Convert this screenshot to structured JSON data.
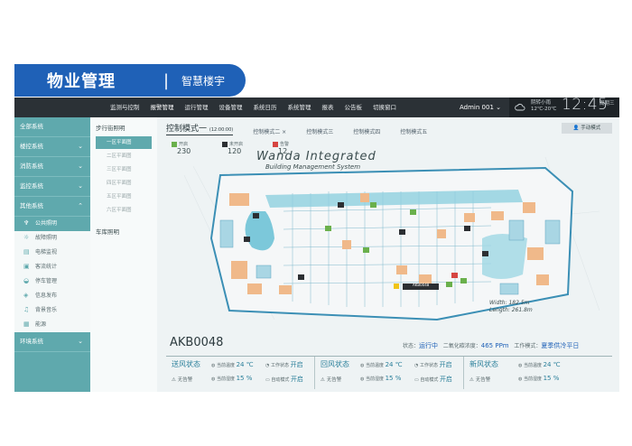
{
  "banner": {
    "title": "物业管理",
    "separator": "|",
    "subtitle": "智慧楼宇"
  },
  "topnav": {
    "items": [
      "监测与控制",
      "报警管理",
      "运行管理",
      "设备管理",
      "系统日历",
      "系统管理",
      "报表",
      "公告板",
      "切换窗口"
    ],
    "active_index": 1,
    "user": "Admin 001 ⌄",
    "weather": {
      "line1": "阴转小雨",
      "line2": "12℃-20℃",
      "time": "12:45",
      "day": "周期三"
    }
  },
  "sidebar": {
    "groups": [
      "全部系统",
      "楼控系统",
      "消防系统",
      "监控系统",
      "其他系统"
    ],
    "subitems": [
      {
        "icon": "lamp-icon",
        "label": "公共照明"
      },
      {
        "icon": "alarm-icon",
        "label": "故障照明"
      },
      {
        "icon": "elevator-icon",
        "label": "电梯监视"
      },
      {
        "icon": "parking-icon",
        "label": "客流统计"
      },
      {
        "icon": "car-icon",
        "label": "停车管理"
      },
      {
        "icon": "info-icon",
        "label": "信息发布"
      },
      {
        "icon": "music-icon",
        "label": "背景音乐"
      },
      {
        "icon": "energy-icon",
        "label": "能源"
      }
    ],
    "selected_sub": 0,
    "footer": "环境系统"
  },
  "subpanel": {
    "head": "步行街照明",
    "floors": [
      "一区平面图",
      "二区平面图",
      "三区平面图",
      "四区平面图",
      "五区平面图",
      "六区平面图"
    ],
    "selected": 0,
    "head2": "车库照明"
  },
  "tabs": {
    "items": [
      {
        "label": "控制模式一",
        "time": "(12:00:00)"
      },
      {
        "label": "控制模式二 ×",
        "time": ""
      },
      {
        "label": "控制模式三",
        "time": ""
      },
      {
        "label": "控制模式四",
        "time": ""
      },
      {
        "label": "控制模式五",
        "time": ""
      }
    ],
    "manual_button": "手动模式"
  },
  "legend": [
    {
      "label": "开启",
      "value": "230",
      "color": "#6ab04c"
    },
    {
      "label": "未开启",
      "value": "120",
      "color": "#2c2f33"
    },
    {
      "label": "告警",
      "value": "12",
      "color": "#d64541"
    }
  ],
  "plan": {
    "title": "Wanda Integrated",
    "subtitle": "Building Management System",
    "width": "Width: 182.5m",
    "length": "Length: 261.8m",
    "tag": "AKB0048"
  },
  "info": {
    "code": "AKB0048",
    "status_label": "状态：",
    "status_value": "运行中",
    "co2_label": "二氧化碳浓度：",
    "co2_value": "465 PPm",
    "mode_label": "工作模式：",
    "mode_value": "夏季供冷平日"
  },
  "cards": [
    {
      "title": "送风状态",
      "temp_label": "当前温度",
      "temp": "24 ℃",
      "hum_label": "当前湿度",
      "hum": "15 %",
      "state_label": "工作状态",
      "state": "开启",
      "auto_label": "自动模式",
      "auto": "开启",
      "alarm": "无告警"
    },
    {
      "title": "回风状态",
      "temp_label": "当前温度",
      "temp": "24 ℃",
      "hum_label": "当前湿度",
      "hum": "15 %",
      "state_label": "工作状态",
      "state": "开启",
      "auto_label": "自动模式",
      "auto": "开启",
      "alarm": "无告警"
    },
    {
      "title": "新风状态",
      "temp_label": "当前温度",
      "temp": "24 ℃",
      "hum_label": "当前湿度",
      "hum": "15 %",
      "alarm": "无告警"
    }
  ],
  "colors": {
    "nav_bg": "#2b3136",
    "sidebar": "#5fa9ad",
    "accent": "#1F61B7",
    "water": "#6ec3d6",
    "ok": "#6ab04c",
    "alarm": "#d64541"
  }
}
